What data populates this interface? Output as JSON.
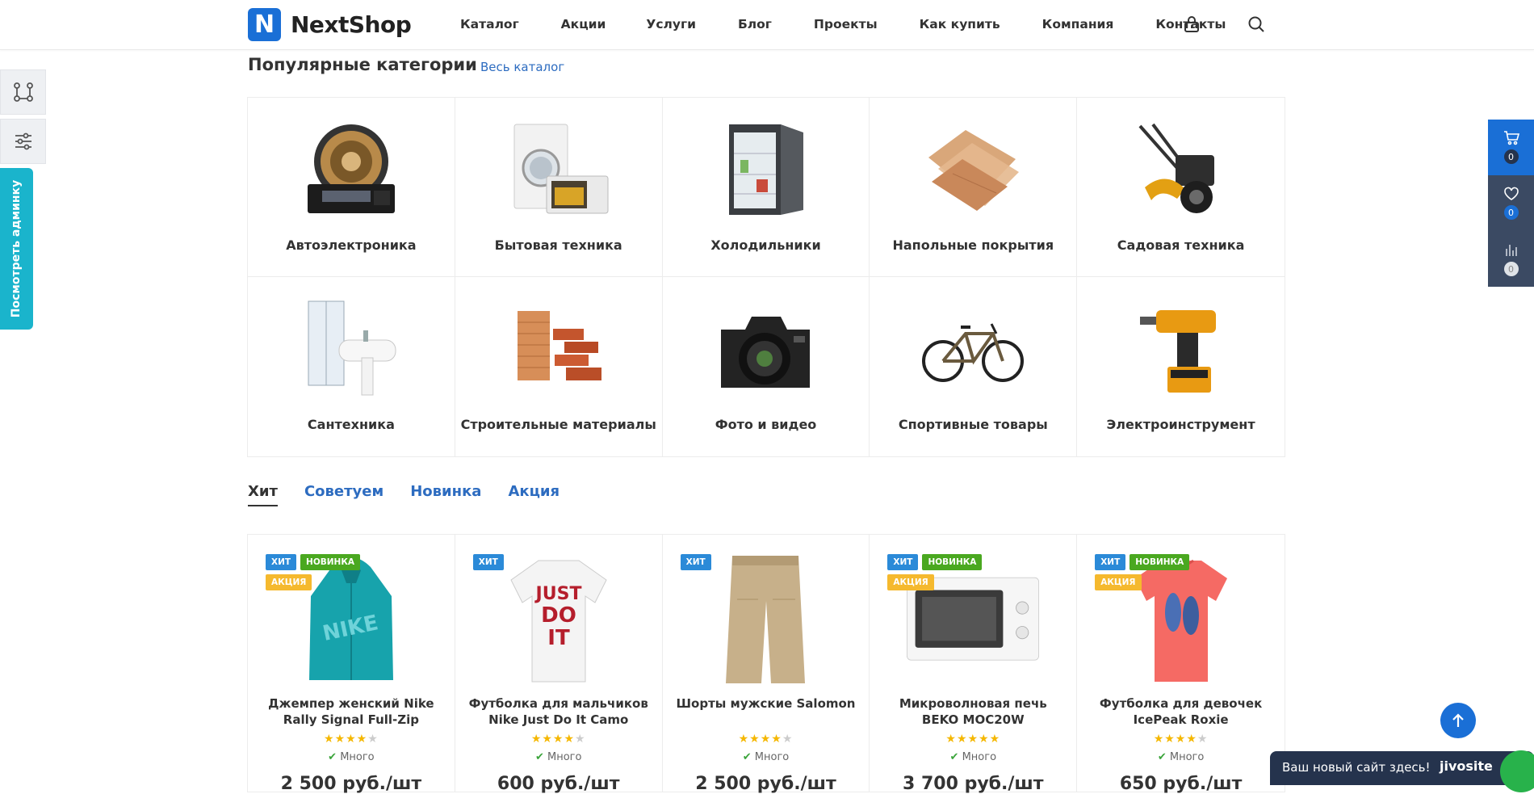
{
  "header": {
    "logo_letter": "N",
    "logo_text": "NextShop",
    "nav": [
      "Каталог",
      "Акции",
      "Услуги",
      "Блог",
      "Проекты",
      "Как купить",
      "Компания",
      "Контакты"
    ],
    "icons": [
      "lock-icon",
      "search-icon"
    ]
  },
  "left_panel": {
    "icons": [
      "compare-flow-icon",
      "settings-sliders-icon"
    ],
    "admin_label": "Посмотреть админку"
  },
  "right_bar": {
    "cart_count": "0",
    "wishlist_count": "0",
    "compare_count": "0",
    "colors": {
      "cart": "#1a6fd6",
      "other": "#3b4a63"
    }
  },
  "popular": {
    "title": "Популярные категории",
    "all_link": "Весь каталог",
    "categories": [
      "Автоэлектроника",
      "Бытовая техника",
      "Холодильники",
      "Напольные покрытия",
      "Садовая техника",
      "Сантехника",
      "Строительные материалы",
      "Фото и видео",
      "Спортивные товары",
      "Электроинструмент"
    ]
  },
  "tabs": [
    "Хит",
    "Советуем",
    "Новинка",
    "Акция"
  ],
  "badge_labels": {
    "hit": "ХИТ",
    "new": "НОВИНКА",
    "sale": "АКЦИЯ"
  },
  "badge_colors": {
    "hit": "#2b8ad8",
    "new": "#4aa820",
    "sale": "#f5b92e"
  },
  "products": [
    {
      "name": "Джемпер женский Nike Rally Signal Full-Zip",
      "rating": 4,
      "stock": "Много",
      "price": "2 500 руб./шт"
    },
    {
      "name": "Футболка для мальчиков Nike Just Do It Camo",
      "rating": 4,
      "stock": "Много",
      "price": "600 руб./шт"
    },
    {
      "name": "Шорты мужские Salomon",
      "rating": 4,
      "stock": "Много",
      "price": "2 500 руб./шт"
    },
    {
      "name": "Микроволновая печь BEKO MOC20W",
      "rating": 5,
      "stock": "Много",
      "price": "3 700 руб./шт"
    },
    {
      "name": "Футболка для девочек IcePeak Roxie",
      "rating": 4,
      "stock": "Много",
      "price": "650 руб./шт"
    }
  ],
  "chat": {
    "text": "Ваш новый сайт здесь!",
    "brand": "jivosite"
  }
}
